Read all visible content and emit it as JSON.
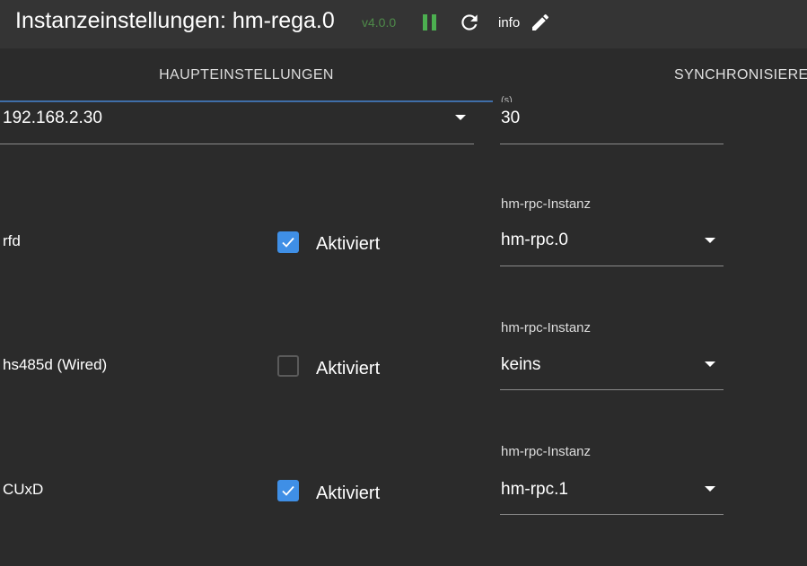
{
  "header": {
    "title": "Instanzeinstellungen: hm-rega.0",
    "version": "v4.0.0",
    "info_label": "info",
    "version_color": "#4e8a49",
    "pause_color": "#4caf50"
  },
  "tabs": [
    {
      "label": "HAUPTEINSTELLUNGEN",
      "active": true
    },
    {
      "label": "SYNCHRONISIERE",
      "active": false
    }
  ],
  "settings": {
    "host_value": "192.168.2.30",
    "interval_label_partial": "(s)",
    "interval_value": "30"
  },
  "rows": [
    {
      "name": "rfd",
      "checked": true,
      "check_label": "Aktiviert",
      "instance_label": "hm-rpc-Instanz",
      "instance_value": "hm-rpc.0"
    },
    {
      "name": "hs485d (Wired)",
      "checked": false,
      "check_label": "Aktiviert",
      "instance_label": "hm-rpc-Instanz",
      "instance_value": "keins"
    },
    {
      "name": "CUxD",
      "checked": true,
      "check_label": "Aktiviert",
      "instance_label": "hm-rpc-Instanz",
      "instance_value": "hm-rpc.1"
    }
  ],
  "colors": {
    "accent": "#3f8fe6",
    "tab_indicator": "#3f6ea8"
  }
}
